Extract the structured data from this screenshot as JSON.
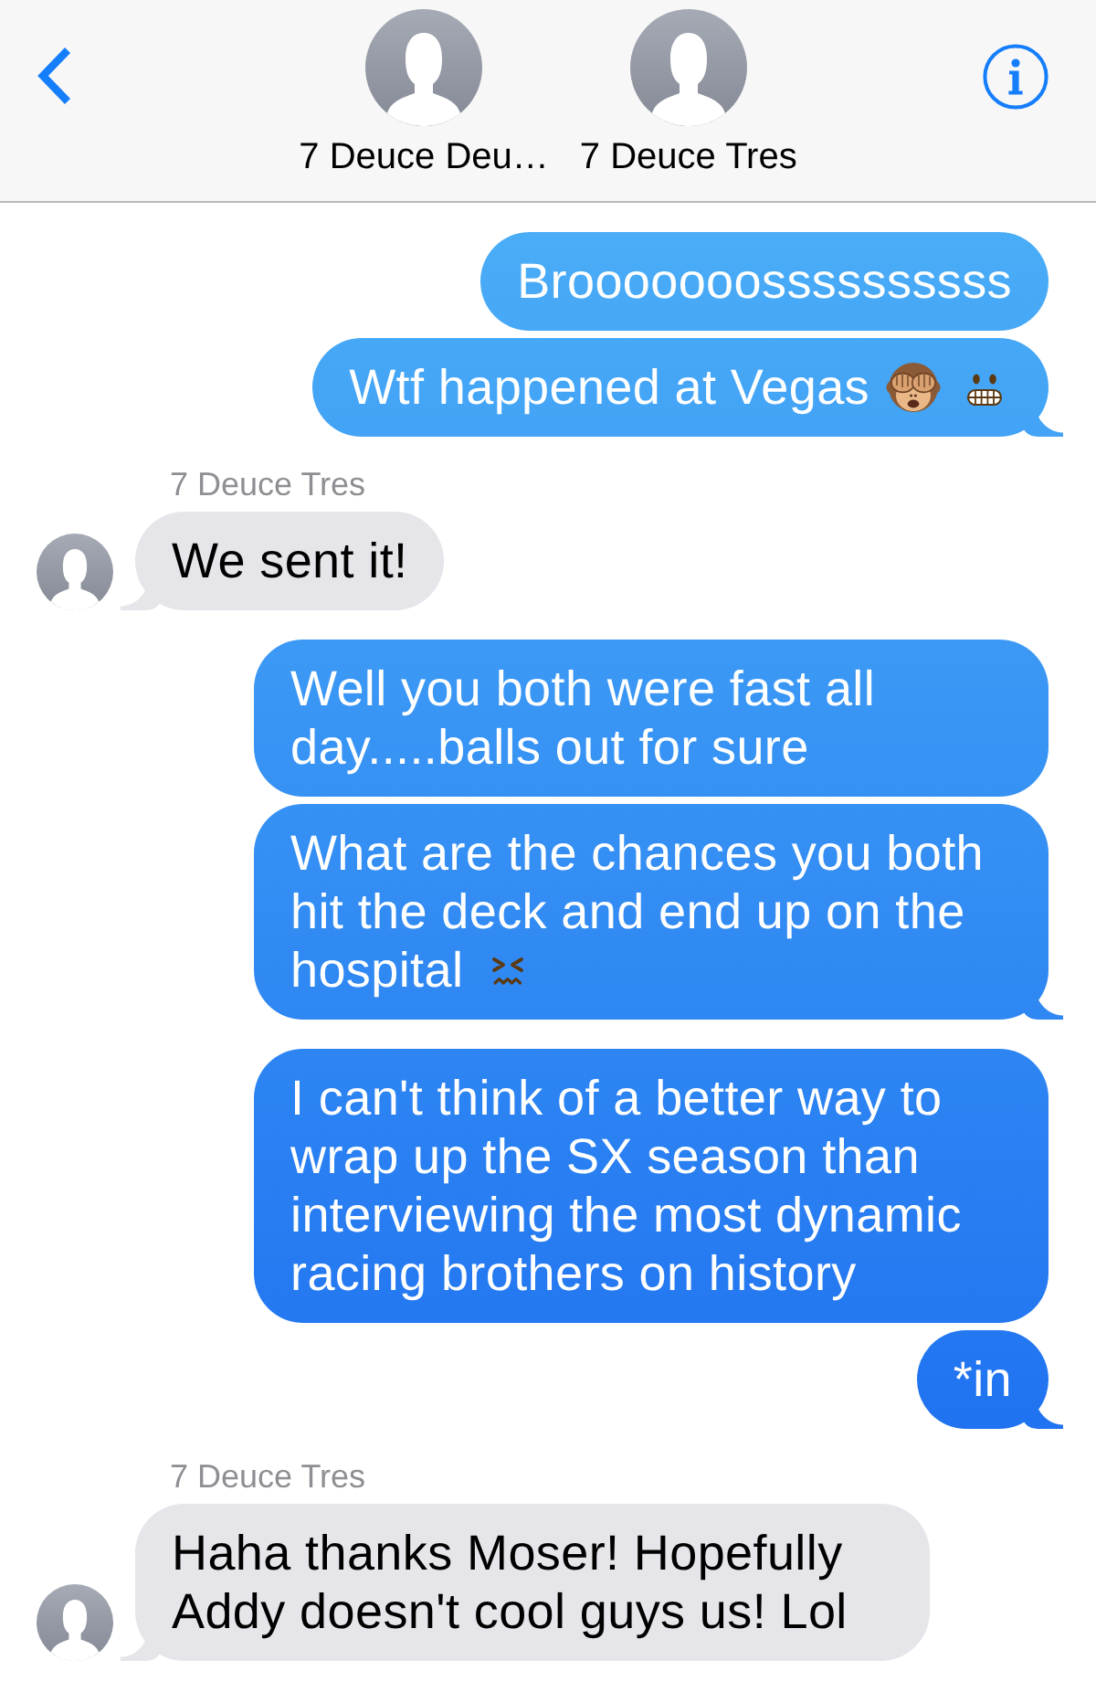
{
  "header": {
    "contacts": [
      {
        "name": "7 Deuce Deu…"
      },
      {
        "name": "7 Deuce Tres"
      }
    ]
  },
  "messages": [
    {
      "kind": "outgoing",
      "text": "Brooooooossssssssss",
      "tail": false
    },
    {
      "kind": "outgoing",
      "text": "Wtf happened at Vegas",
      "emoji": [
        {
          "kind": "monkey"
        },
        {
          "kind": "grimacing"
        }
      ],
      "tail": true
    },
    {
      "kind": "incoming",
      "sender": "7 Deuce Tres",
      "text": "We sent it!",
      "tail": true
    },
    {
      "kind": "outgoing",
      "text": "Well you both were fast all day.....balls out for sure",
      "tail": false
    },
    {
      "kind": "outgoing",
      "text": "What are the chances you both hit the deck and end up on the hospital",
      "emoji": [
        {
          "kind": "confounded"
        }
      ],
      "tail": true
    },
    {
      "kind": "outgoing",
      "text": "I can't think of a better way to wrap up the SX season than interviewing the most dynamic racing brothers on history",
      "tail": false
    },
    {
      "kind": "outgoing",
      "text": "*in",
      "tail": true
    },
    {
      "kind": "incoming",
      "sender": "7 Deuce Tres",
      "text": "Haha thanks Moser! Hopefully Addy doesn't cool guys us! Lol",
      "tail": true
    }
  ]
}
